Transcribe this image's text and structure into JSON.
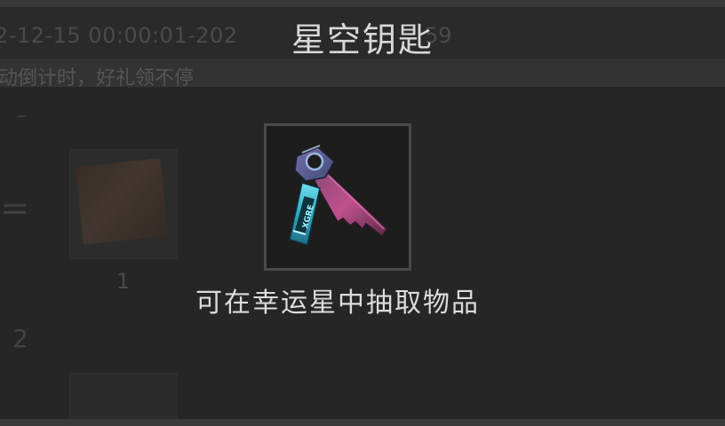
{
  "background": {
    "date_range": "2-12-15 00:00:01-202",
    "date_tail": "59",
    "notice": "动倒计时，好礼领不停",
    "equals_sign": "=",
    "card_count": "1",
    "list_index": "2"
  },
  "popup": {
    "item_name": "星空钥匙",
    "item_icon": "star-key-icon",
    "item_description": "可在幸运星中抽取物品"
  },
  "colors": {
    "overlay_text": "#dcdcdc",
    "frame_border": "#4a4a4a",
    "key_handle": "#3fc7d8",
    "key_blade": "#c0508c"
  }
}
